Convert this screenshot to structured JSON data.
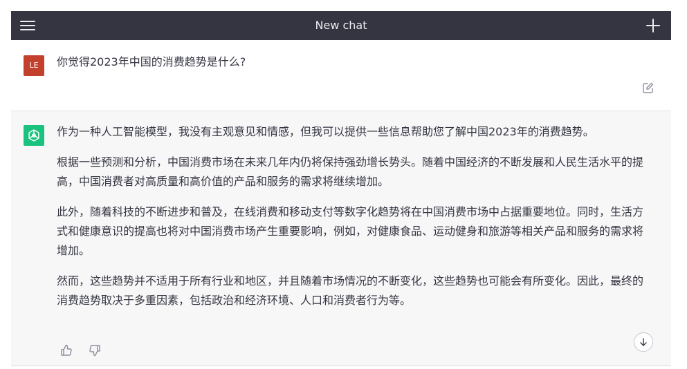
{
  "header": {
    "title": "New chat",
    "menu_icon": "hamburger-menu-icon",
    "new_chat_icon": "plus-icon"
  },
  "user_message": {
    "avatar_initials": "LE",
    "avatar_color": "#c2402c",
    "text": "你觉得2023年中国的消费趋势是什么?"
  },
  "assistant_message": {
    "avatar_color": "#19c37d",
    "paragraphs": [
      "作为一种人工智能模型，我没有主观意见和情感，但我可以提供一些信息帮助您了解中国2023年的消费趋势。",
      "根据一些预测和分析，中国消费市场在未来几年内仍将保持强劲增长势头。随着中国经济的不断发展和人民生活水平的提高，中国消费者对高质量和高价值的产品和服务的需求将继续增加。",
      "此外，随着科技的不断进步和普及，在线消费和移动支付等数字化趋势将在中国消费市场中占据重要地位。同时，生活方式和健康意识的提高也将对中国消费市场产生重要影响，例如，对健康食品、运动健身和旅游等相关产品和服务的需求将增加。",
      "然而，这些趋势并不适用于所有行业和地区，并且随着市场情况的不断变化，这些趋势也可能会有所变化。因此，最终的消费趋势取决于多重因素，包括政治和经济环境、人口和消费者行为等。"
    ]
  },
  "colors": {
    "topbar_bg": "#343541",
    "assistant_bg": "#f7f7f8",
    "text": "#343541"
  }
}
